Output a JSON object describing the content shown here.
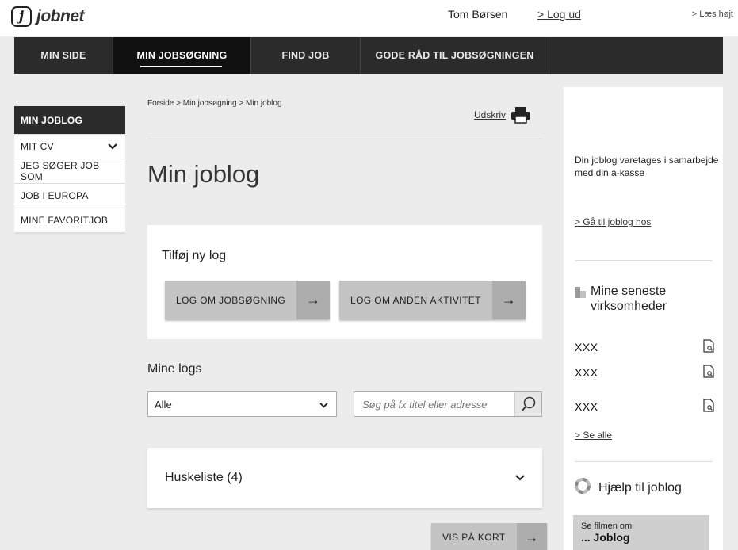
{
  "header": {
    "logo_mark": "j",
    "logo_text": "jobnet",
    "user_name": "Tom Børsen",
    "logout_label": "> Log ud",
    "read_aloud_label": "> Læs højt"
  },
  "main_nav": [
    {
      "label": "MIN SIDE",
      "active": false
    },
    {
      "label": "MIN JOBSØGNING",
      "active": true
    },
    {
      "label": "FIND JOB",
      "active": false
    },
    {
      "label": "GODE RÅD TIL JOBSØGNINGEN",
      "active": false
    }
  ],
  "left_nav": [
    {
      "label": "MIN JOBLOG",
      "active": true
    },
    {
      "label": "MIT CV",
      "has_chevron": true
    },
    {
      "label": "JEG SØGER JOB SOM"
    },
    {
      "label": "JOB I EUROPA"
    },
    {
      "label": "MINE FAVORITJOB"
    }
  ],
  "content": {
    "breadcrumb": "Forside > Min jobsøgning > Min joblog",
    "print_label": "Udskriv",
    "page_title": "Min joblog",
    "add_log": {
      "title": "Tilføj ny log",
      "button_job": "LOG OM JOBSØGNING",
      "button_other": "LOG OM ANDEN AKTIVITET",
      "arrow": "→"
    },
    "my_logs": {
      "title": "Mine logs",
      "filter_selected": "Alle",
      "search_placeholder": "Søg på fx titel eller adresse"
    },
    "huskeliste": {
      "title": "Huskeliste (4)"
    },
    "map_button": "VIS PÅ KORT"
  },
  "right": {
    "akasse_text": "Din joblog varetages i samarbejde med din a-kasse",
    "goto_link": "> Gå til joblog hos",
    "recent_title": "Mine seneste virksomheder",
    "companies": [
      "XXX",
      "XXX",
      "XXX"
    ],
    "see_all": "> Se alle",
    "help_label": "Hjælp til joblog",
    "film_small": "Se filmen om",
    "film_big": "... Joblog"
  },
  "colors": {
    "nav_bg": "#2b2b2b",
    "nav_active": "#111111",
    "page_bg": "#ececec",
    "button_bg": "#c4c4c4"
  }
}
